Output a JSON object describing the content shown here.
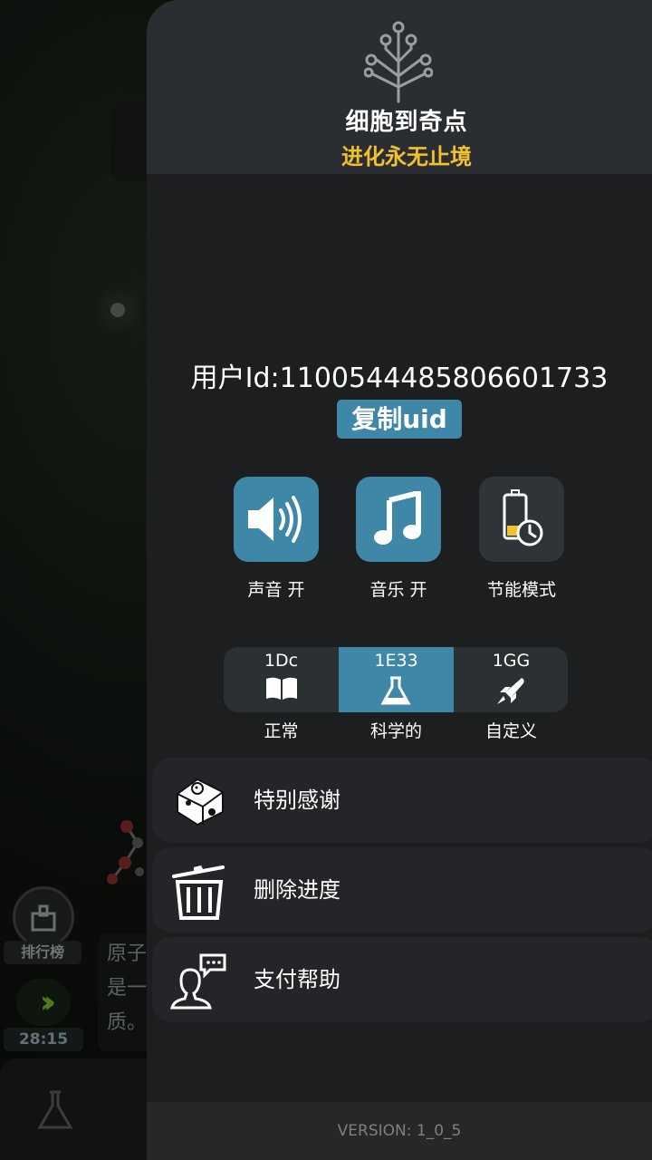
{
  "background": {
    "rank_label": "排行榜",
    "timer": "28:15",
    "text_lines": [
      "原子",
      "是一",
      "质。"
    ]
  },
  "header": {
    "title": "细胞到奇点",
    "subtitle": "进化永无止境"
  },
  "account": {
    "user_id_text": "用户Id:1100544485806601733",
    "copy_button_label": "复制uid"
  },
  "toggles": [
    {
      "icon": "speaker-icon",
      "label": "声音 开",
      "state": "on"
    },
    {
      "icon": "music-note-icon",
      "label": "音乐 开",
      "state": "on"
    },
    {
      "icon": "battery-clock-icon",
      "label": "节能模式",
      "state": "off"
    }
  ],
  "notation": {
    "options": [
      {
        "value": "1Dc",
        "label": "正常",
        "icon": "book-icon"
      },
      {
        "value": "1E33",
        "label": "科学的",
        "icon": "flask-icon"
      },
      {
        "value": "1GG",
        "label": "自定义",
        "icon": "rocket-icon"
      }
    ],
    "selected": "科学的"
  },
  "menu": [
    {
      "icon": "cheese-mouse-icon",
      "label": "特别感谢"
    },
    {
      "icon": "trash-icon",
      "label": "删除进度"
    },
    {
      "icon": "support-chat-icon",
      "label": "支付帮助"
    }
  ],
  "footer": {
    "version": "VERSION: 1_0_5"
  },
  "colors": {
    "accent": "#3e87a6",
    "subtitle": "#f2c12e",
    "drawer_bg": "#1d1e20",
    "header_bg": "#2a2d31"
  }
}
